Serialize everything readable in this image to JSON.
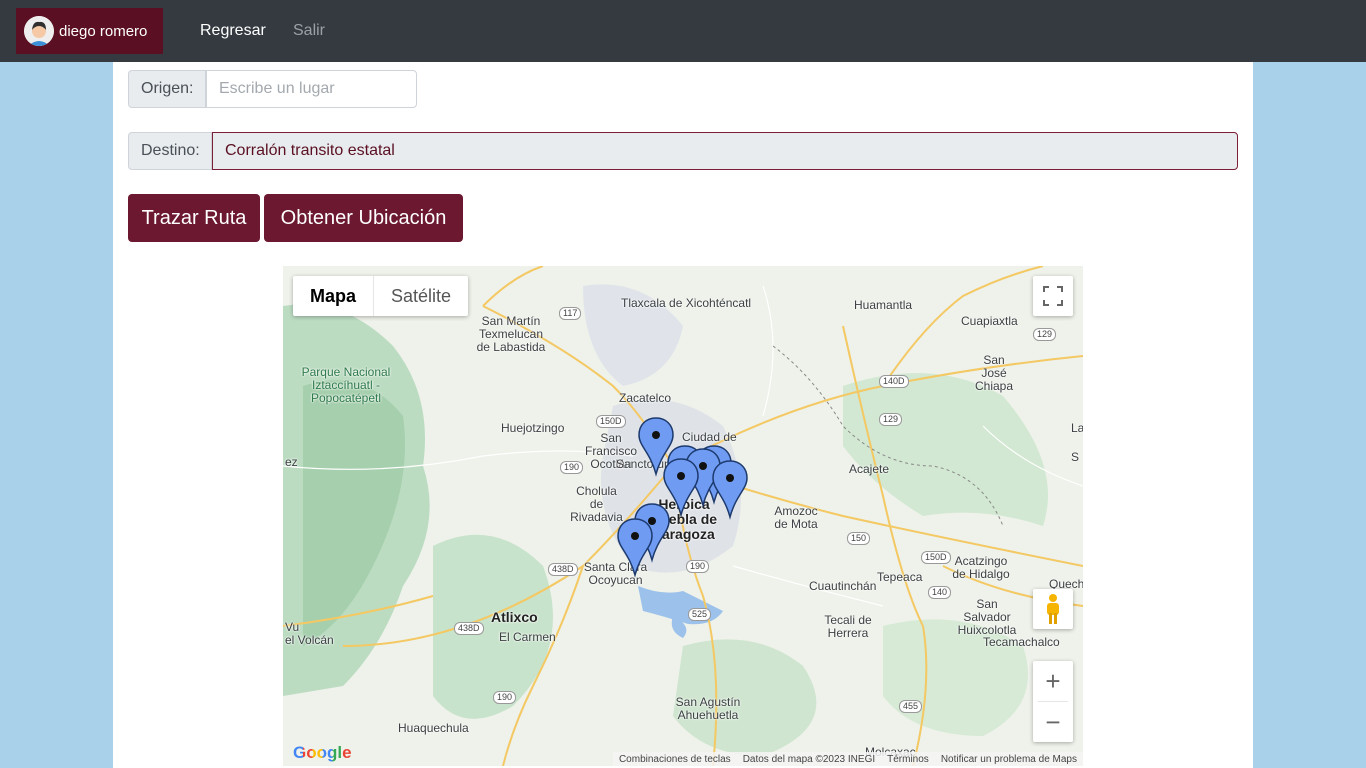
{
  "navbar": {
    "user_name": "diego romero",
    "links": {
      "regresar": "Regresar",
      "salir": "Salir"
    }
  },
  "form": {
    "origen_label": "Origen:",
    "origen_placeholder": "Escribe un lugar",
    "destino_label": "Destino:",
    "destino_value": "Corralón transito estatal"
  },
  "buttons": {
    "trazar": "Trazar Ruta",
    "ubicacion": "Obtener Ubicación"
  },
  "map": {
    "type_options": [
      "Mapa",
      "Satélite"
    ],
    "selected_type": "Mapa",
    "logo": "Google",
    "attribution": [
      "Combinaciones de teclas",
      "Datos del mapa ©2023 INEGI",
      "Términos",
      "Notificar un problema de Maps"
    ],
    "places": {
      "tlaxcala": "Tlaxcala de Xicohténcatl",
      "huamantla": "Huamantla",
      "cuapiaxtla": "Cuapiaxtla",
      "san_martin": "San Martín Texmelucan de Labastida",
      "san_jose_chiapa": "San José Chiapa",
      "parque": "Parque Nacional Iztaccíhuatl - Popocatépetl",
      "zacatelco": "Zacatelco",
      "huejotzingo": "Huejotzingo",
      "san_francisco": "San Francisco Ocotlán",
      "sanctorum": "Sanctorum",
      "ciudad_de": "Ciudad de",
      "acajete": "Acajete",
      "cholula": "Cholula de Rivadavia",
      "heroica": "Heroica Puebla de Zaragoza",
      "amozoc": "Amozoc de Mota",
      "santa_clara": "Santa Clara Ocoyucan",
      "acatzingo": "Acatzingo de Hidalgo",
      "cuautinchan": "Cuautinchán",
      "tepeaca": "Tepeaca",
      "atlixco": "Atlixco",
      "el_carmen": "El Carmen",
      "san_salvador": "San Salvador Huixcolotla",
      "tecali": "Tecali de Herrera",
      "tecamachalco": "Tecamachalco",
      "el_volcan": "el Volcán",
      "san_agustin": "San Agustín Ahuehuetla",
      "huaquechula": "Huaquechula",
      "molcaxac": "Molcaxac",
      "ez": "ez",
      "quech": "Quech",
      "la": "La",
      "s": "S",
      "vuelta": "Vu"
    },
    "shields": [
      "117",
      "150D",
      "140D",
      "129",
      "129",
      "190",
      "438D",
      "190",
      "525",
      "150",
      "150D",
      "140",
      "438D",
      "190",
      "455"
    ],
    "marker_count": 8
  },
  "colors": {
    "accent": "#6b1830",
    "navbar": "#343a40",
    "page_bg": "#a9d1ea"
  }
}
